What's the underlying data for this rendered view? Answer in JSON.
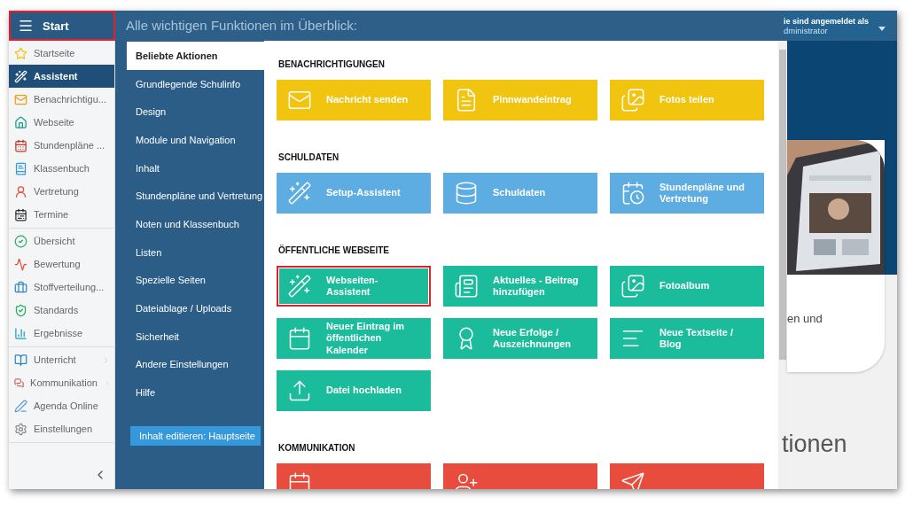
{
  "start": {
    "label": "Start",
    "highlighted": true
  },
  "header": {
    "title": "Alle wichtigen Funktionen im Überblick:",
    "login_label": "ie sind angemeldet als",
    "user": "dministrator"
  },
  "sidebar": {
    "groups": [
      {
        "items": [
          {
            "label": "Startseite",
            "selected": false,
            "has_submenu": false
          },
          {
            "label": "Assistent",
            "selected": true,
            "has_submenu": false
          },
          {
            "label": "Benachrichtigu...",
            "selected": false,
            "has_submenu": false
          },
          {
            "label": "Webseite",
            "selected": false,
            "has_submenu": false
          },
          {
            "label": "Stundenpläne ...",
            "selected": false,
            "has_submenu": false
          },
          {
            "label": "Klassenbuch",
            "selected": false,
            "has_submenu": false
          },
          {
            "label": "Vertretung",
            "selected": false,
            "has_submenu": false
          },
          {
            "label": "Termine",
            "selected": false,
            "has_submenu": false
          }
        ]
      },
      {
        "items": [
          {
            "label": "Übersicht",
            "selected": false,
            "has_submenu": false
          },
          {
            "label": "Bewertung",
            "selected": false,
            "has_submenu": false
          },
          {
            "label": "Stoffverteilung...",
            "selected": false,
            "has_submenu": false
          },
          {
            "label": "Standards",
            "selected": false,
            "has_submenu": false
          },
          {
            "label": "Ergebnisse",
            "selected": false,
            "has_submenu": false
          }
        ]
      },
      {
        "items": [
          {
            "label": "Unterricht",
            "selected": false,
            "has_submenu": true
          },
          {
            "label": "Kommunikation",
            "selected": false,
            "has_submenu": true
          },
          {
            "label": "Agenda Online",
            "selected": false,
            "has_submenu": false
          },
          {
            "label": "Einstellungen",
            "selected": false,
            "has_submenu": false
          }
        ]
      }
    ]
  },
  "menu": {
    "items": [
      {
        "label": "Beliebte Aktionen",
        "selected": true
      },
      {
        "label": "Grundlegende Schulinfo",
        "selected": false
      },
      {
        "label": "Design",
        "selected": false
      },
      {
        "label": "Module und Navigation",
        "selected": false
      },
      {
        "label": "Inhalt",
        "selected": false
      },
      {
        "label": "Stundenpläne und Vertretung",
        "selected": false
      },
      {
        "label": "Noten und Klassenbuch",
        "selected": false
      },
      {
        "label": "Listen",
        "selected": false
      },
      {
        "label": "Spezielle Seiten",
        "selected": false
      },
      {
        "label": "Dateiablage / Uploads",
        "selected": false
      },
      {
        "label": "Sicherheit",
        "selected": false
      },
      {
        "label": "Andere Einstellungen",
        "selected": false
      },
      {
        "label": "Hilfe",
        "selected": false
      }
    ],
    "edit_button": "Inhalt editieren: Hauptseite"
  },
  "sections": [
    {
      "title": "BENACHRICHTIGUNGEN",
      "color": "#f1c40f",
      "tiles": [
        {
          "label": "Nachricht senden",
          "highlighted": false
        },
        {
          "label": "Pinnwandeintrag",
          "highlighted": false
        },
        {
          "label": "Fotos teilen",
          "highlighted": false
        }
      ]
    },
    {
      "title": "SCHULDATEN",
      "color": "#5dade2",
      "tiles": [
        {
          "label": "Setup-Assistent",
          "highlighted": false
        },
        {
          "label": "Schuldaten",
          "highlighted": false
        },
        {
          "label": "Stundenpläne und Vertretung",
          "highlighted": false
        }
      ]
    },
    {
      "title": "ÖFFENTLICHE WEBSEITE",
      "color": "#1abc9c",
      "tiles": [
        {
          "label": "Webseiten-Assistent",
          "highlighted": true
        },
        {
          "label": "Aktuelles - Beitrag hinzufügen",
          "highlighted": false
        },
        {
          "label": "Fotoalbum",
          "highlighted": false
        },
        {
          "label": "Neuer Eintrag im öffentlichen Kalender",
          "highlighted": false
        },
        {
          "label": "Neue Erfolge / Auszeichnungen",
          "highlighted": false
        },
        {
          "label": "Neue Textseite / Blog",
          "highlighted": false
        },
        {
          "label": "Datei hochladen",
          "highlighted": false
        }
      ]
    },
    {
      "title": "KOMMUNIKATION",
      "color": "#e74c3c",
      "tiles": [
        {
          "highlighted": false
        },
        {
          "highlighted": false
        },
        {
          "highlighted": false
        }
      ]
    }
  ],
  "background": {
    "text_1": "en und",
    "text_2": "tionen"
  }
}
